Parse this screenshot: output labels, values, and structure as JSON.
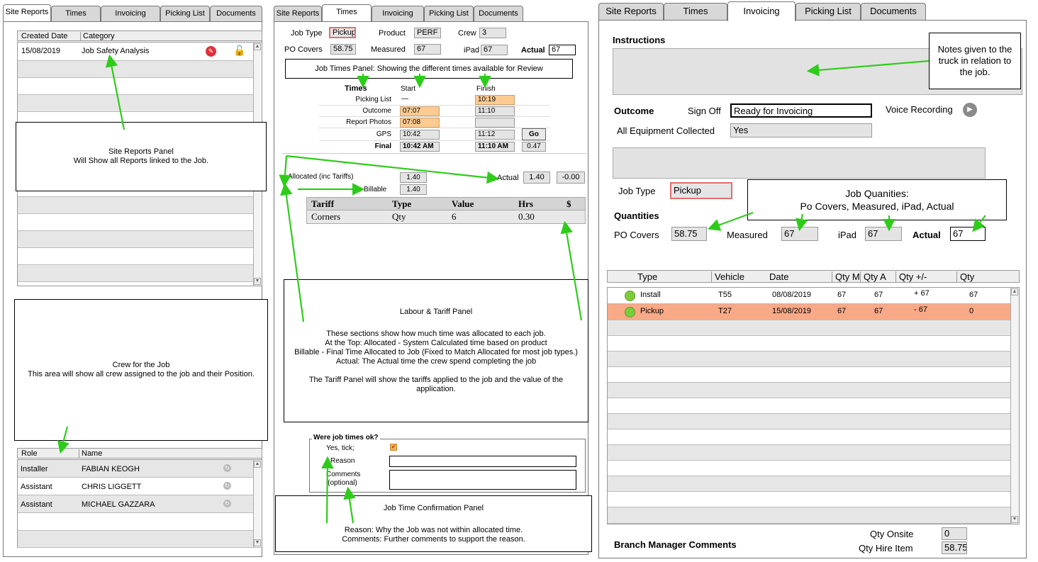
{
  "panel1": {
    "tabs": [
      "Site Reports",
      "Times",
      "Invoicing",
      "Picking List",
      "Documents"
    ],
    "grid_headers": [
      "Created Date",
      "Category"
    ],
    "report": {
      "date": "15/08/2019",
      "category": "Job Safety Analysis"
    },
    "note_title": "Site Reports Panel",
    "note_body": "Will Show all Reports linked to the Job.",
    "crew_note_title": "Crew for the Job",
    "crew_note_body": "This area will show all crew assigned to the job and their Position.",
    "crew_headers": [
      "Role",
      "Name"
    ],
    "crew": [
      {
        "role": "Installer",
        "name": "FABIAN KEOGH"
      },
      {
        "role": "Assistant",
        "name": "CHRIS LIGGETT"
      },
      {
        "role": "Assistant",
        "name": "MICHAEL GAZZARA"
      }
    ]
  },
  "panel2": {
    "tabs": [
      "Site Reports",
      "Times",
      "Invoicing",
      "Picking List",
      "Documents"
    ],
    "job_type_label": "Job Type",
    "job_type": "Pickup",
    "product_label": "Product",
    "product": "PERF",
    "crew_label": "Crew",
    "crew": "3",
    "po_label": "PO Covers",
    "po": "58.75",
    "measured_label": "Measured",
    "measured": "67",
    "ipad_label": "iPad",
    "ipad": "67",
    "actual_label": "Actual",
    "actual": "67",
    "times_note": "Job Times Panel: Showing the different times available for Review",
    "col_times": "Times",
    "col_start": "Start",
    "col_finish": "Finish",
    "rows": [
      {
        "label": "Picking List",
        "start": "—",
        "finish": "10:19"
      },
      {
        "label": "Outcome",
        "start": "07:07",
        "finish": "11:10"
      },
      {
        "label": "Report Photos",
        "start": "07:08",
        "finish": ""
      },
      {
        "label": "GPS",
        "start": "10:42",
        "finish": "11:12"
      },
      {
        "label": "Final",
        "start": "10:42 AM",
        "finish": "11:10 AM"
      }
    ],
    "go": "Go",
    "final_hrs": "0.47",
    "allocated_label": "Allocated (inc Tariffs)",
    "allocated": "1.40",
    "billable_label": "Billable",
    "billable": "1.40",
    "actual2_label": "Actual",
    "actual2": "1.40",
    "diff": "-0.00",
    "tariff_headers": [
      "Tariff",
      "Type",
      "Value",
      "Hrs",
      "$"
    ],
    "tariff_row": [
      "Corners",
      "Qty",
      "6",
      "0.30",
      ""
    ],
    "labour_title": "Labour & Tariff Panel",
    "labour_lines": [
      "These sections show how much time was allocated to each job.",
      "At the Top: Allocated - System Calculated time based on product",
      "Billable - Final Time Allocated to Job (Fixed to Match Allocated for most job types.)",
      "Actual: The Actual time the crew spend completing the job",
      "",
      "The Tariff Panel will show the tariffs applied to the job and the value of the application."
    ],
    "ok_legend": "Were job times ok?",
    "yes_label": "Yes, tick;",
    "reason_label": "Reason",
    "comments_label": "Comments (optional)",
    "confirm_title": "Job Time Confirmation Panel",
    "confirm_line1": "Reason: Why the Job was not within allocated time.",
    "confirm_line2": "Comments: Further comments to support the reason."
  },
  "panel3": {
    "tabs": [
      "Site Reports",
      "Times",
      "Invoicing",
      "Picking List",
      "Documents"
    ],
    "instructions": "Instructions",
    "notes_note": "Notes given to the truck in relation to the job.",
    "outcome": "Outcome",
    "signoff_label": "Sign Off",
    "signoff": "Ready for Invoicing",
    "voice": "Voice Recording",
    "equip_label": "All Equipment Collected",
    "equip": "Yes",
    "job_type_label": "Job Type",
    "job_type": "Pickup",
    "qty_note_title": "Job Quanities:",
    "qty_note_body": "Po Covers, Measured, iPad, Actual",
    "quantities": "Quantities",
    "po_label": "PO Covers",
    "po": "58.75",
    "measured_label": "Measured",
    "measured": "67",
    "ipad_label": "iPad",
    "ipad": "67",
    "actual_label": "Actual",
    "actual": "67",
    "headers": [
      "Type",
      "Vehicle",
      "Date",
      "Qty M",
      "Qty A",
      "Qty +/-",
      "Qty"
    ],
    "rows": [
      {
        "type": "Install",
        "vehicle": "T55",
        "date": "08/08/2019",
        "qm": "67",
        "qa": "67",
        "pm": "+ 67",
        "qty": "67"
      },
      {
        "type": "Pickup",
        "vehicle": "T27",
        "date": "15/08/2019",
        "qm": "67",
        "qa": "67",
        "pm": "- 67",
        "qty": "0"
      }
    ],
    "branch": "Branch Manager Comments",
    "onsite_label": "Qty Onsite",
    "onsite": "0",
    "hire_label": "Qty Hire Item",
    "hire": "58.75"
  },
  "colors": {
    "orange": "#fdcb92",
    "row_highlight": "#f8a987",
    "arrow": "#2ecc1a",
    "icon_red": "#e0303a",
    "status_green": "#7ccc3c"
  }
}
